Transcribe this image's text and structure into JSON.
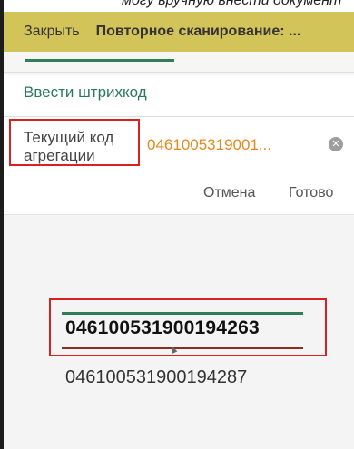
{
  "top_strip": {
    "partial_text": "могу вручную внести документ"
  },
  "toolbar": {
    "close_label": "Закрыть",
    "title": "Повторное сканирование: ..."
  },
  "form": {
    "enter_barcode_label": "Ввести штрихкод",
    "current_code_label": "Текущий код агрегации",
    "current_code_value": "0461005319001...",
    "clear_icon": "clear-circle-icon"
  },
  "picker": {
    "cancel_label": "Отмена",
    "done_label": "Готово",
    "selected_value": "046100531900194263",
    "next_value": "046100531900194287"
  },
  "colors": {
    "toolbar": "#d3c45a",
    "accent_green": "#2a7a5a",
    "value_orange": "#e28a1e",
    "highlight_red": "#d92121"
  }
}
